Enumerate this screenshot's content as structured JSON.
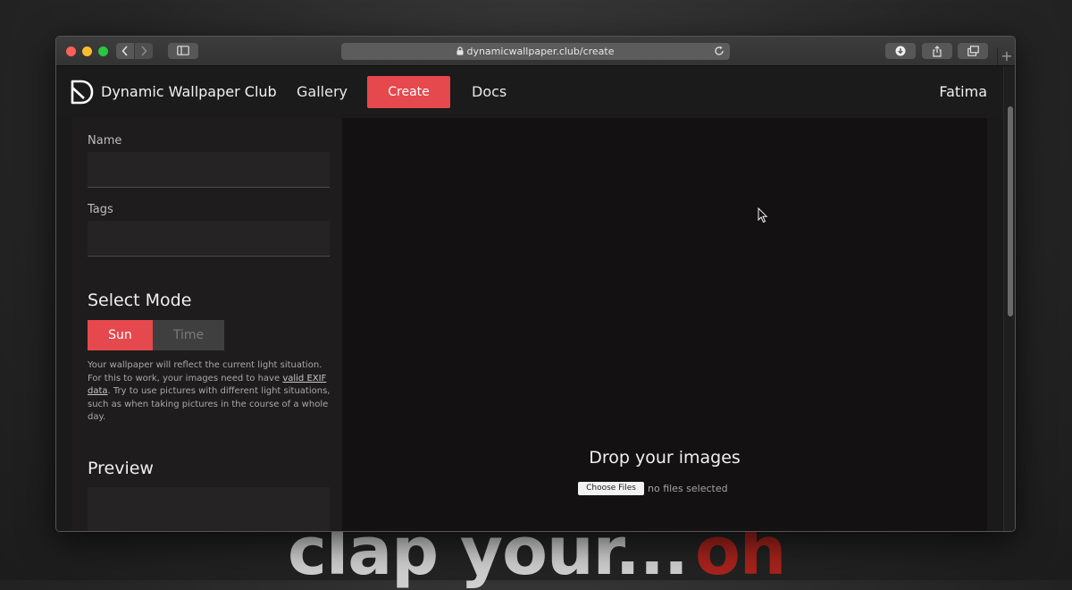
{
  "browser": {
    "url": "dynamicwallpaper.club/create",
    "new_tab_label": "+"
  },
  "nav": {
    "brand": "Dynamic Wallpaper Club",
    "gallery": "Gallery",
    "create": "Create",
    "docs": "Docs",
    "user": "Fatima"
  },
  "form": {
    "name_label": "Name",
    "name_value": "",
    "tags_label": "Tags",
    "tags_value": "",
    "select_mode_title": "Select Mode",
    "mode_sun": "Sun",
    "mode_time": "Time",
    "selected_mode": "Sun",
    "help_text_1": "Your wallpaper will reflect the current light situation. For this to work, your images need to have ",
    "help_link": "valid EXIF data",
    "help_text_2": ". Try to use pictures with different light situations, such as when taking pictures in the course of a whole day.",
    "preview_title": "Preview"
  },
  "dropzone": {
    "title": "Drop your images",
    "choose_files": "Choose Files",
    "no_files": "no files selected"
  },
  "background": {
    "text_main": "clap your...",
    "text_accent": "oh"
  },
  "colors": {
    "accent": "#e5484d",
    "page_bg": "#1a1a1a",
    "dropzone_bg": "#131112"
  }
}
